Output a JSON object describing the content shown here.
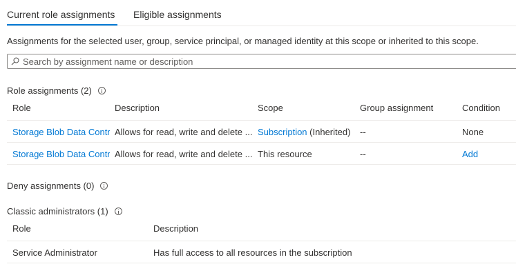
{
  "tabs": [
    {
      "label": "Current role assignments",
      "active": true
    },
    {
      "label": "Eligible assignments",
      "active": false
    }
  ],
  "intro_text": "Assignments for the selected user, group, service principal, or managed identity at this scope or inherited to this scope.",
  "search": {
    "placeholder": "Search by assignment name or description",
    "value": ""
  },
  "role_assignments": {
    "title": "Role assignments (2)",
    "columns": [
      "Role",
      "Description",
      "Scope",
      "Group assignment",
      "Condition"
    ],
    "rows": [
      {
        "role": "Storage Blob Data Contr",
        "description": "Allows for read, write and delete ...",
        "scope_link": "Subscription",
        "scope_suffix": "(Inherited)",
        "group": "--",
        "condition": "None"
      },
      {
        "role": "Storage Blob Data Contr",
        "description": "Allows for read, write and delete ...",
        "scope_text": "This resource",
        "group": "--",
        "condition": "Add"
      }
    ]
  },
  "deny_assignments": {
    "title": "Deny assignments (0)"
  },
  "classic_admins": {
    "title": "Classic administrators (1)",
    "columns": [
      "Role",
      "Description"
    ],
    "rows": [
      {
        "role": "Service Administrator",
        "description": "Has full access to all resources in the subscription"
      }
    ]
  },
  "colors": {
    "accent": "#0078d4",
    "text": "#323130",
    "divider": "#edebe9"
  }
}
